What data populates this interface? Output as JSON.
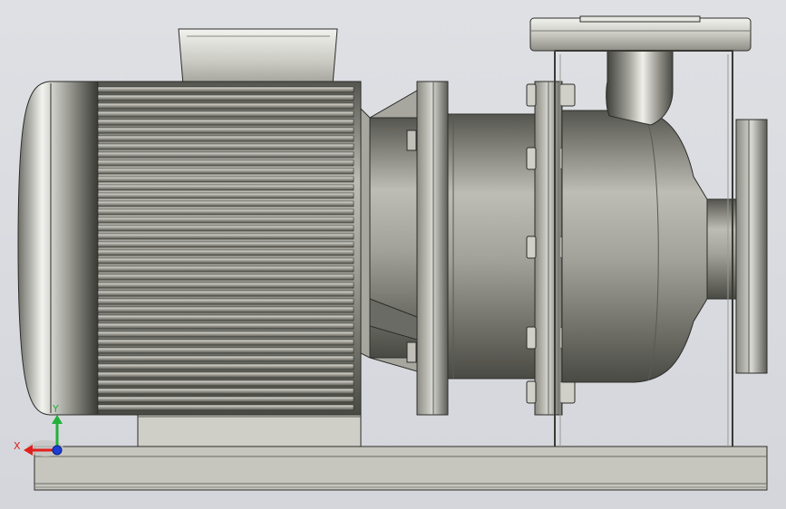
{
  "triad": {
    "x_label": "X",
    "y_label": "Y",
    "x_color": "#e0201c",
    "y_color": "#22b13a",
    "z_color": "#1a3fd6"
  },
  "colors": {
    "background": "#d9dadf",
    "metal_dark": "#4b4b45",
    "metal_mid": "#9c9c94",
    "metal_light": "#eeeeea",
    "baseplate": "#c4c4bd"
  }
}
